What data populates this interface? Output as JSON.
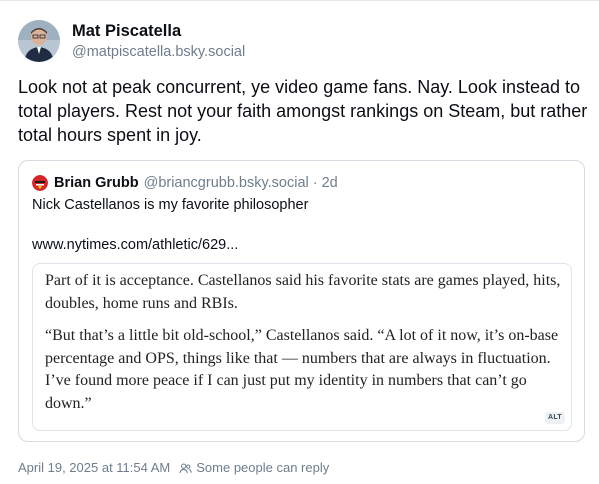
{
  "post": {
    "author": {
      "display_name": "Mat Piscatella",
      "handle": "@matpiscatella.bsky.social",
      "avatar_icon": "person-avatar"
    },
    "text": "Look not at peak concurrent, ye video game fans. Nay. Look instead to total players. Rest not your faith amongst rankings on Steam, but rather total hours spent in joy.",
    "quote": {
      "author_name": "Brian Grubb",
      "author_handle": "@briancgrubb.bsky.social",
      "separator": "·",
      "time": "2d",
      "avatar_icon": "red-avatar",
      "text": "Nick Castellanos is my favorite philosopher",
      "link": "www.nytimes.com/athletic/629...",
      "image": {
        "paragraph_1": "Part of it is acceptance. Castellanos said his favorite stats are games played, hits, doubles, home runs and RBIs.",
        "paragraph_2": "“But that’s a little bit old-school,” Castellanos said. “A lot of it now, it’s on-base percentage and OPS, things like that — numbers that are always in fluctuation. I’ve found more peace if I can just put my identity in numbers that can’t go down.”",
        "alt_badge": "ALT"
      }
    },
    "footer": {
      "timestamp": "April 19, 2025 at 11:54 AM",
      "reply_settings": "Some people can reply",
      "reply_icon": "people-icon"
    }
  },
  "colors": {
    "text": "#0b0f14",
    "muted": "#6f7d8c",
    "border": "#d4dbe2"
  }
}
